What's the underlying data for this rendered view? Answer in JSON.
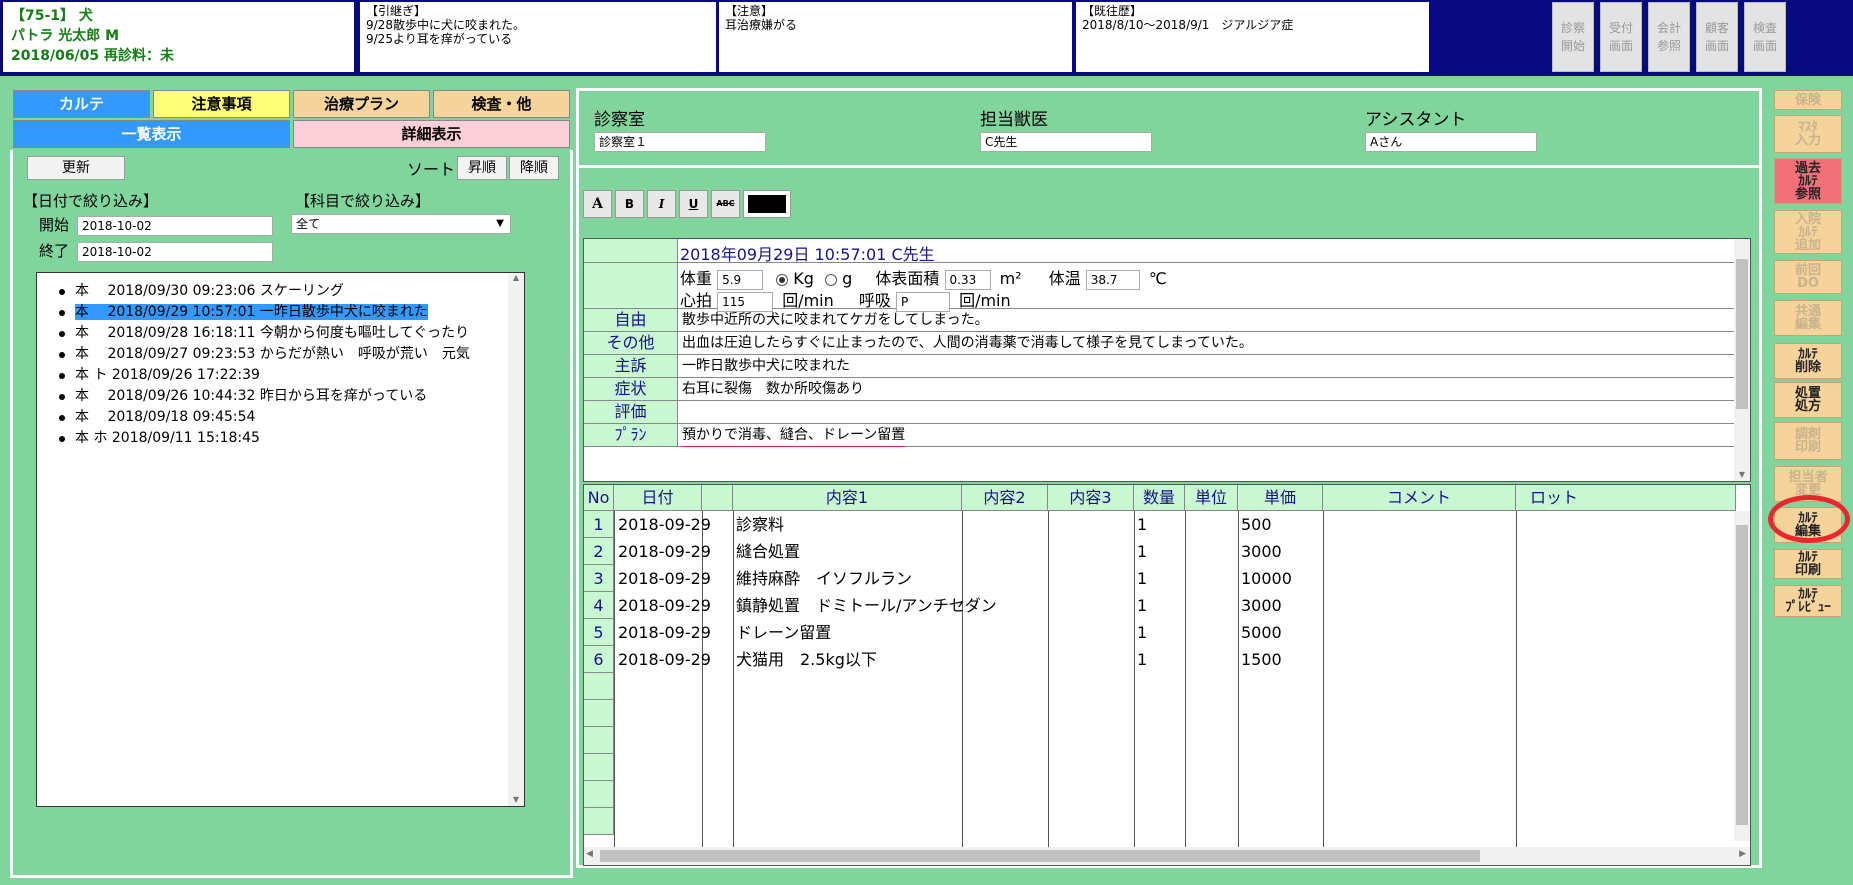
{
  "header": {
    "patient": {
      "id_line": "【75-1】 犬",
      "name_line": "パトラ 光太郎 M",
      "date_line": "2018/06/05 再診料：未"
    },
    "handover": {
      "title": "【引継ぎ】",
      "lines": [
        "9/28散歩中に犬に咬まれた。",
        "9/25より耳を痒がっている"
      ]
    },
    "caution": {
      "title": "【注意】",
      "lines": [
        "耳治療嫌がる"
      ]
    },
    "history": {
      "title": "【既往歴】",
      "lines": [
        "2018/8/10〜2018/9/1　ジアルジア症"
      ]
    },
    "buttons": [
      "診察\n開始",
      "受付\n画面",
      "会計\n参照",
      "顧客\n画面",
      "検査\n画面"
    ]
  },
  "left": {
    "tabs": [
      "カルテ",
      "注意事項",
      "治療プラン",
      "検査・他"
    ],
    "subtabs": [
      "一覧表示",
      "詳細表示"
    ],
    "refresh_label": "更新",
    "sort_label": "ソート",
    "sort_asc": "昇順",
    "sort_desc": "降順",
    "date_filter_label": "【日付で絞り込み】",
    "subject_filter_label": "【科目で絞り込み】",
    "start_label": "開始",
    "end_label": "終了",
    "start_value": "2018-10-02",
    "end_value": "2018-10-02",
    "subject_value": "全て",
    "records": [
      "本　 2018/09/30 09:23:06 スケーリング",
      "本　 2018/09/29 10:57:01 一昨日散歩中犬に咬まれた",
      "本　 2018/09/28 16:18:11 今朝から何度も嘔吐してぐったり",
      "本　 2018/09/27 09:23:53 からだが熱い　呼吸が荒い　元気",
      "本 ト 2018/09/26 17:22:39",
      "本　 2018/09/26 10:44:32 昨日から耳を痒がっている",
      "本　 2018/09/18 09:45:54",
      "本 ホ 2018/09/11 15:18:45"
    ]
  },
  "top": {
    "room_label": "診察室",
    "room_value": "診察室１",
    "doctor_label": "担当獣医",
    "doctor_value": "C先生",
    "assistant_label": "アシスタント",
    "assistant_value": "Aさん"
  },
  "format": {
    "buttons": [
      "A",
      "B",
      "I",
      "U",
      "ABC"
    ],
    "color": "#000000"
  },
  "record": {
    "title": "2018年09月29日 10:57:01 C先生",
    "weight_label": "体重",
    "weight": "5.9",
    "unit_kg": "Kg",
    "unit_g": "g",
    "bsa_label": "体表面積",
    "bsa": "0.33",
    "bsa_unit": "m²",
    "temp_label": "体温",
    "temp": "38.7",
    "temp_unit": "℃",
    "pulse_label": "心拍",
    "pulse": "115",
    "pulse_unit": "回/min",
    "resp_label": "呼吸",
    "resp": "P",
    "resp_unit": "回/min",
    "rows": [
      {
        "label": "自由",
        "value": "散歩中近所の犬に咬まれてケガをしてしまった。"
      },
      {
        "label": "その他",
        "value": "出血は圧迫したらすぐに止まったので、人間の消毒薬で消毒して様子を見てしまっていた。"
      },
      {
        "label": "主訴",
        "value": "一昨日散歩中犬に咬まれた"
      },
      {
        "label": "症状",
        "value": "右耳に裂傷　数か所咬傷あり"
      },
      {
        "label": "評価",
        "value": ""
      },
      {
        "label": "ﾌﾟﾗﾝ",
        "value": "預かりで消毒、縫合、ドレーン留置"
      }
    ]
  },
  "items": {
    "headers": [
      "No",
      "日付",
      "",
      "内容1",
      "内容2",
      "内容3",
      "数量",
      "単位",
      "単価",
      "コメント",
      "ロット"
    ],
    "rows": [
      {
        "no": "1",
        "date": "2018-09-29",
        "content1": "診察料",
        "qty": "1",
        "price": "500"
      },
      {
        "no": "2",
        "date": "2018-09-29",
        "content1": "縫合処置",
        "qty": "1",
        "price": "3000"
      },
      {
        "no": "3",
        "date": "2018-09-29",
        "content1": "維持麻酔　イソフルラン",
        "qty": "1",
        "price": "10000"
      },
      {
        "no": "4",
        "date": "2018-09-29",
        "content1": "鎮静処置　ドミトール/アンチセダン",
        "qty": "1",
        "price": "3000"
      },
      {
        "no": "5",
        "date": "2018-09-29",
        "content1": "ドレーン留置",
        "qty": "1",
        "price": "5000"
      },
      {
        "no": "6",
        "date": "2018-09-29",
        "content1": "犬猫用　2.5kg以下",
        "qty": "1",
        "price": "1500"
      }
    ]
  },
  "sidebar": [
    {
      "label": "保険",
      "active": false
    },
    {
      "label": "ﾏｽﾀ\n入力",
      "active": false
    },
    {
      "label": "過去\nｶﾙﾃ\n参照",
      "active": true
    },
    {
      "label": "入院\nｶﾙﾃ\n追加",
      "active": false
    },
    {
      "label": "前回\nDO",
      "active": false
    },
    {
      "label": "共通\n編集",
      "active": false
    },
    {
      "label": "ｶﾙﾃ\n削除",
      "active": true
    },
    {
      "label": "処置\n処方",
      "active": true
    },
    {
      "label": "調剤\n印刷",
      "active": false
    },
    {
      "label": "担当者\n変更",
      "active": false
    },
    {
      "label": "ｶﾙﾃ\n編集",
      "active": true
    },
    {
      "label": "ｶﾙﾃ\n印刷",
      "active": true
    },
    {
      "label": "ｶﾙﾃ\nﾌﾟﾚﾋﾞｭｰ",
      "active": true
    }
  ],
  "colors": {
    "accent_red": "#e8282e",
    "header_bg": "#0a0a80",
    "panel_bg": "#7fd59b",
    "label_bg": "#c9f7d2"
  }
}
